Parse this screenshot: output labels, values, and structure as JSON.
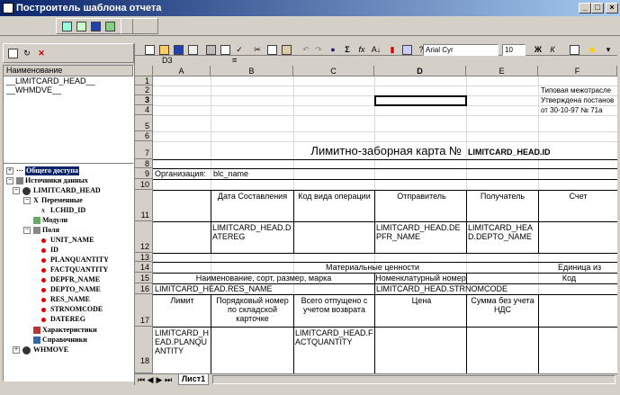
{
  "window": {
    "title": "Построитель шаблона отчета"
  },
  "left": {
    "list_header": "Наименование",
    "list_items": [
      "__LIMITCARD_HEAD__",
      "__WHMDVE__"
    ],
    "tree": [
      {
        "label": "Общего доступа",
        "selected": true
      },
      {
        "label": "Источники данных"
      },
      {
        "label": "LIMITCARD_HEAD"
      },
      {
        "label": "Переменные"
      },
      {
        "label": "LCHID_ID"
      },
      {
        "label": "Модули"
      },
      {
        "label": "Поля"
      },
      {
        "label": "UNIT_NAME"
      },
      {
        "label": "ID"
      },
      {
        "label": "PLANQUANTITY"
      },
      {
        "label": "FACTQUANTITY"
      },
      {
        "label": "DEPFR_NAME"
      },
      {
        "label": "DEPTO_NAME"
      },
      {
        "label": "RES_NAME"
      },
      {
        "label": "STRNOMCODE"
      },
      {
        "label": "DATEREG"
      },
      {
        "label": "Характеристики"
      },
      {
        "label": "Справочники"
      },
      {
        "label": "WHMOVE"
      }
    ]
  },
  "formula": {
    "cell_ref": "D3",
    "eq": "="
  },
  "format": {
    "font": "Arial Cyr",
    "size": "10",
    "bold": "Ж",
    "italic": "К"
  },
  "columns": [
    "A",
    "B",
    "C",
    "D",
    "E",
    "F"
  ],
  "rows": [
    "1",
    "2",
    "3",
    "4",
    "5",
    "6",
    "7",
    "8",
    "9",
    "10",
    "11",
    "12",
    "13",
    "14",
    "15",
    "16",
    "17",
    "18"
  ],
  "cells": {
    "f2": "Типовая межотрасле",
    "f3": "Утверждена постанов",
    "f4": "от 30-10-97 № 71а",
    "title": "Лимитно-заборная карта №",
    "title_field": "LIMITCARD_HEAD.ID",
    "org_label": "Организация:",
    "org_value": "blc_name",
    "b11": "Дата Составления",
    "c11": "Код вида операции",
    "d11": "Отправитель",
    "e11": "Получатель",
    "f11": "Счет",
    "b12": "LIMITCARD_HEAD.DATEREG",
    "d12": "LIMITCARD_HEAD.DEPFR_NAME",
    "e12": "LIMITCARD_HEAD.DEPTO_NAME",
    "mat": "Материальные ценности",
    "unit": "Единица из",
    "name_hdr": "Наименование, сорт, размер, марка",
    "nom_hdr": "Номенклатурный номер",
    "code_hdr": "Код",
    "a16": "LIMITCARD_HEAD.RES_NAME",
    "d16": "LIMITCARD_HEAD.STRNOMCODE",
    "a17": "Лимит",
    "b17": "Порядковый номер по складской карточке",
    "c17": "Всего отпущено с учетом возврата",
    "d17": "Цена",
    "e17": "Сумма без учета НДС",
    "a18": "LIMITCARD_HEAD.PLANQUANTITY",
    "c18": "LIMITCARD_HEAD.FACTQUANTITY"
  },
  "sheet_tab": "Лист1"
}
